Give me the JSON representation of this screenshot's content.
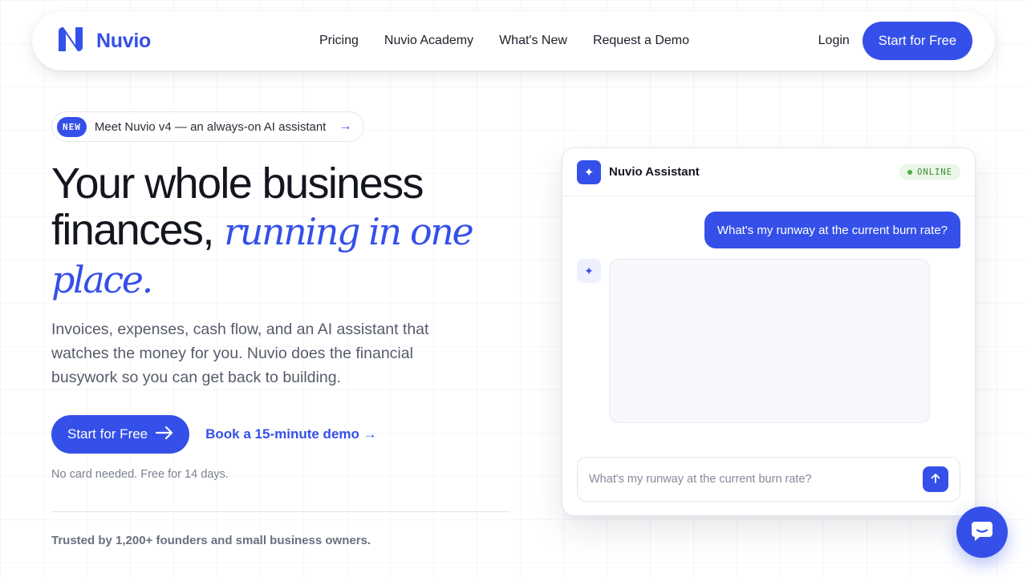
{
  "brand": {
    "name": "Nuvio",
    "logo_icon": "nuvio-n-logo-icon",
    "accent_color": "#3550e8"
  },
  "nav": {
    "links": [
      "Pricing",
      "Nuvio Academy",
      "What's New",
      "Request a Demo"
    ],
    "login": "Login",
    "cta": "Start for Free"
  },
  "announcement": {
    "tag": "NEW",
    "text": "Meet Nuvio v4 — an always-on AI assistant",
    "arrow": "→"
  },
  "hero": {
    "title_line1": "Your whole business",
    "title_line2": "finances,",
    "title_accent": "running in one place.",
    "subtitle": "Invoices, expenses, cash flow, and an AI assistant that watches the money for you. Nuvio does the financial busywork so you can get back to building.",
    "primary_cta": "Start for Free",
    "secondary_cta": "Book a 15-minute demo →",
    "note": "No card needed. Free for 14 days.",
    "trusted": "Trusted by 1,200+ founders and small business owners."
  },
  "assistant": {
    "icon": "sparkle-icon",
    "title": "Nuvio Assistant",
    "status": "ONLINE",
    "user_message": "What's my runway at the current burn rate?",
    "input_placeholder": "What's my runway at the current burn rate?",
    "send_icon": "arrow-up-icon"
  },
  "chat_fab_icon": "chat-bubble-icon"
}
